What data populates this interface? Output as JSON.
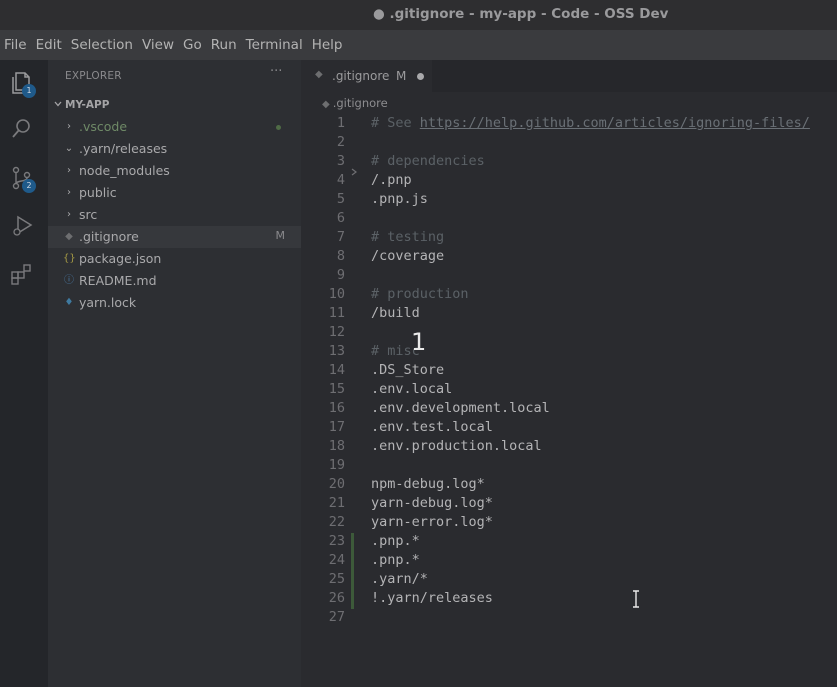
{
  "window": {
    "title": "● .gitignore - my-app - Code - OSS Dev"
  },
  "menu": [
    "File",
    "Edit",
    "Selection",
    "View",
    "Go",
    "Run",
    "Terminal",
    "Help"
  ],
  "activity": {
    "explorer_badge": "1",
    "scm_badge": "2"
  },
  "sidebar": {
    "title": "EXPLORER",
    "more": "···",
    "root": "MY-APP",
    "items": [
      {
        "label": ".vscode",
        "type": "folder",
        "decoration": ""
      },
      {
        "label": ".yarn/releases",
        "type": "folder-open",
        "decoration": ""
      },
      {
        "label": "node_modules",
        "type": "folder",
        "decoration": ""
      },
      {
        "label": "public",
        "type": "folder",
        "decoration": ""
      },
      {
        "label": "src",
        "type": "folder",
        "decoration": ""
      },
      {
        "label": ".gitignore",
        "type": "file",
        "decoration": "M"
      },
      {
        "label": "package.json",
        "type": "json",
        "decoration": ""
      },
      {
        "label": "README.md",
        "type": "info",
        "decoration": ""
      },
      {
        "label": "yarn.lock",
        "type": "yarn",
        "decoration": ""
      }
    ]
  },
  "editor": {
    "tab": {
      "label": ".gitignore",
      "modified": "M"
    },
    "breadcrumb": ".gitignore",
    "lines": [
      {
        "num": "1",
        "text": "# See ",
        "link": "https://help.github.com/articles/ignoring-files/",
        "comment": true
      },
      {
        "num": "2",
        "text": ""
      },
      {
        "num": "3",
        "text": "# dependencies",
        "comment": true
      },
      {
        "num": "4",
        "text": "/.pnp"
      },
      {
        "num": "5",
        "text": ".pnp.js"
      },
      {
        "num": "6",
        "text": ""
      },
      {
        "num": "7",
        "text": "# testing",
        "comment": true
      },
      {
        "num": "8",
        "text": "/coverage"
      },
      {
        "num": "9",
        "text": ""
      },
      {
        "num": "10",
        "text": "# production",
        "comment": true
      },
      {
        "num": "11",
        "text": "/build"
      },
      {
        "num": "12",
        "text": ""
      },
      {
        "num": "13",
        "text": "# misc",
        "comment": true
      },
      {
        "num": "14",
        "text": ".DS_Store"
      },
      {
        "num": "15",
        "text": ".env.local"
      },
      {
        "num": "16",
        "text": ".env.development.local"
      },
      {
        "num": "17",
        "text": ".env.test.local"
      },
      {
        "num": "18",
        "text": ".env.production.local"
      },
      {
        "num": "19",
        "text": ""
      },
      {
        "num": "20",
        "text": "npm-debug.log*"
      },
      {
        "num": "21",
        "text": "yarn-debug.log*"
      },
      {
        "num": "22",
        "text": "yarn-error.log*"
      },
      {
        "num": "23",
        "text": ".pnp.*"
      },
      {
        "num": "24",
        "text": ".pnp.*"
      },
      {
        "num": "25",
        "text": ".yarn/*"
      },
      {
        "num": "26",
        "text": "!.yarn/releases"
      },
      {
        "num": "27",
        "text": ""
      }
    ]
  },
  "overlay": {
    "step": "1"
  },
  "colors": {
    "modified_gutter": "#3d5a3a",
    "badge": "#1f5a8a"
  }
}
